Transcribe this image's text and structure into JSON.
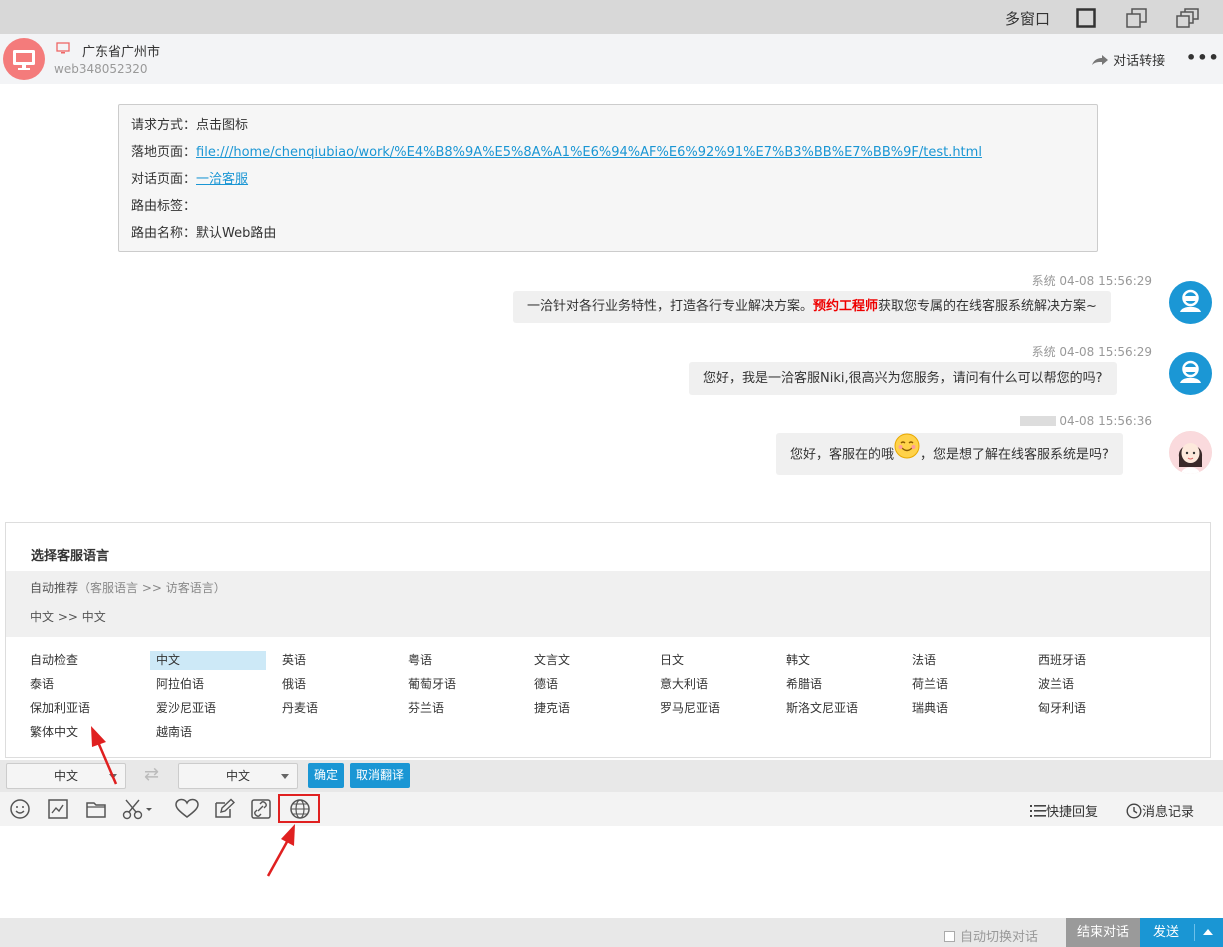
{
  "window": {
    "multi_window_label": "多窗口"
  },
  "header": {
    "location": "广东省广州市",
    "visitor_id": "web348052320",
    "transfer_label": "对话转接",
    "more_label": "•••"
  },
  "info": {
    "rows": [
      {
        "label": "请求方式：",
        "value": "点击图标",
        "link": false
      },
      {
        "label": "落地页面：",
        "value": "file:///home/chenqiubiao/work/%E4%B8%9A%E5%8A%A1%E6%94%AF%E6%92%91%E7%B3%BB%E7%BB%9F/test.html",
        "link": true
      },
      {
        "label": "对话页面：",
        "value": "一洽客服",
        "link": true
      },
      {
        "label": "路由标签：",
        "value": "",
        "link": false
      },
      {
        "label": "路由名称：",
        "value": "默认Web路由",
        "link": false
      }
    ]
  },
  "messages": [
    {
      "sender": "系统",
      "time": "04-08 15:56:29",
      "pre": "一洽针对各行业务特性，打造各行专业解决方案。",
      "highlight": "预约工程师",
      "post": "获取您专属的在线客服系统解决方案~"
    },
    {
      "sender": "系统",
      "time": "04-08 15:56:29",
      "text": "您好，我是一洽客服Niki,很高兴为您服务，请问有什么可以帮您的吗?"
    },
    {
      "sender": "",
      "time": "04-08 15:56:36",
      "pre": "您好，客服在的哦",
      "post": "，您是想了解在线客服系统是吗?"
    }
  ],
  "language_panel": {
    "title": "选择客服语言",
    "auto_label": "自动推荐",
    "auto_hint": "（客服语言 >> 访客语言）",
    "auto_pair": "中文 >> 中文",
    "languages": [
      "自动检查",
      "中文",
      "英语",
      "粤语",
      "文言文",
      "日文",
      "韩文",
      "法语",
      "西班牙语",
      "泰语",
      "阿拉伯语",
      "俄语",
      "葡萄牙语",
      "德语",
      "意大利语",
      "希腊语",
      "荷兰语",
      "波兰语",
      "保加利亚语",
      "爱沙尼亚语",
      "丹麦语",
      "芬兰语",
      "捷克语",
      "罗马尼亚语",
      "斯洛文尼亚语",
      "瑞典语",
      "匈牙利语",
      "繁体中文",
      "越南语"
    ],
    "selected": "中文"
  },
  "translate_bar": {
    "from": "中文",
    "to": "中文",
    "confirm_label": "确定",
    "cancel_label": "取消翻译"
  },
  "toolbar": {
    "quick_reply_label": "快捷回复",
    "history_label": "消息记录"
  },
  "bottom": {
    "auto_switch_label": "自动切换对话",
    "end_label": "结束对话",
    "send_label": "发送"
  },
  "colors": {
    "accent": "#1a96d4",
    "highlight": "#e00000",
    "annotation": "#e02020"
  }
}
